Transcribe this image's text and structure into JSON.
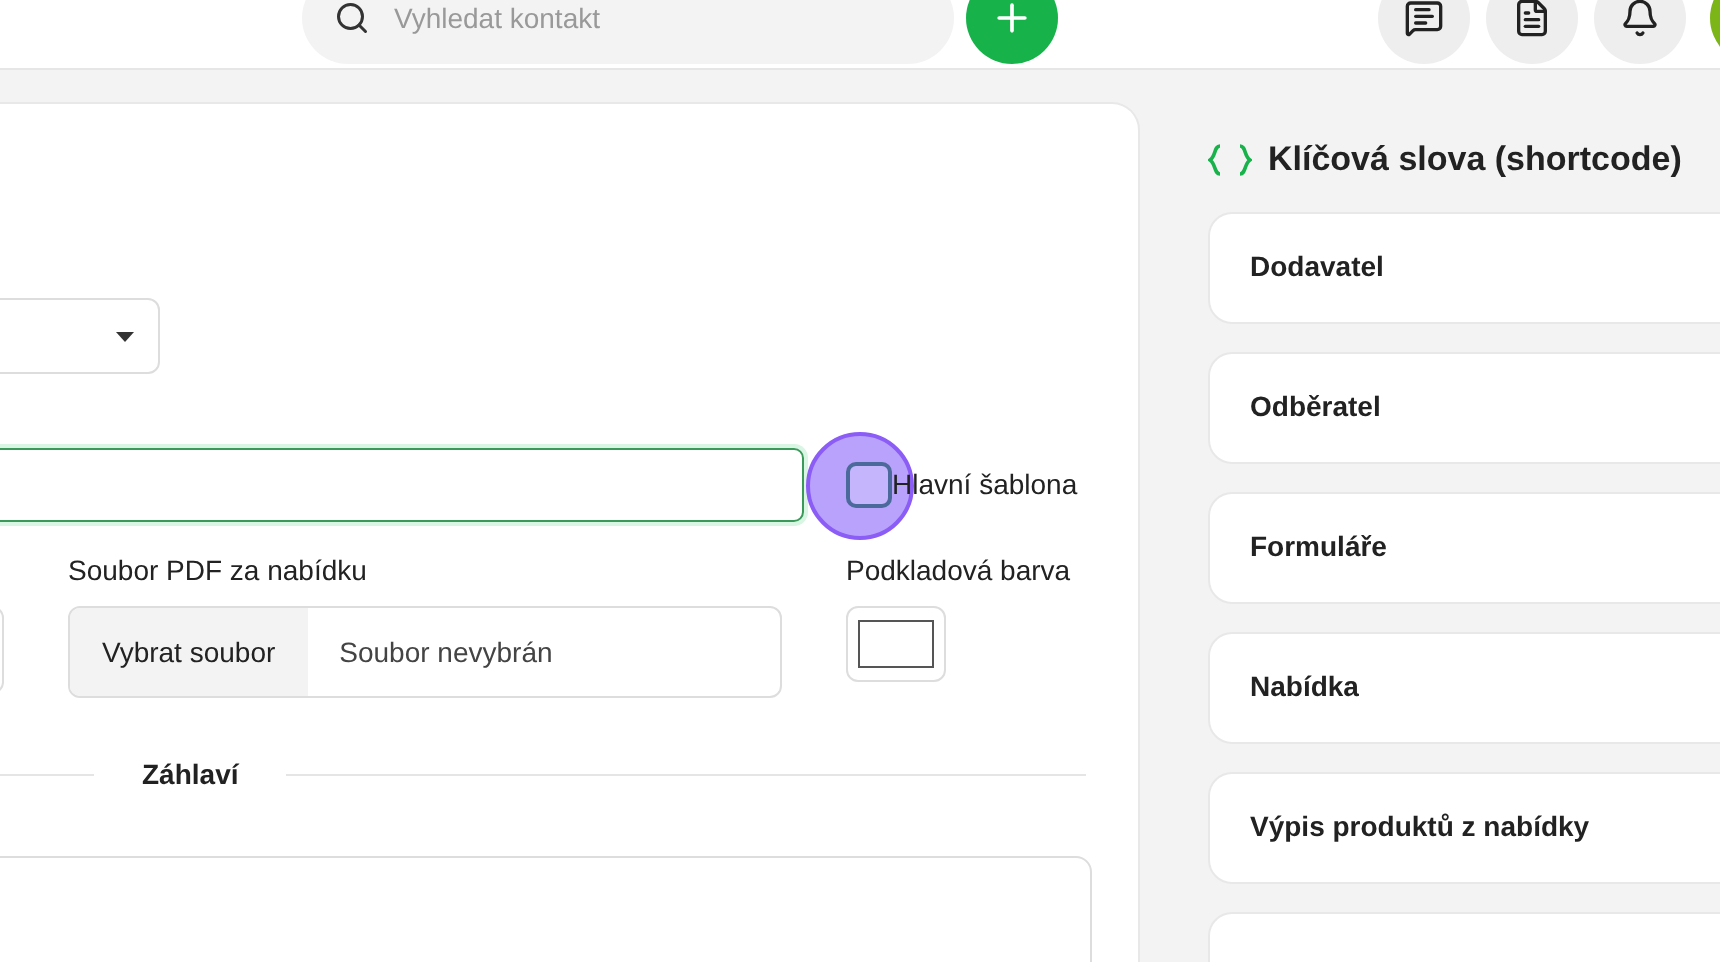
{
  "header": {
    "search": {
      "placeholder": "Vyhledat kontakt"
    }
  },
  "form": {
    "main_template": {
      "label": "Hlavní šablona",
      "checked": false
    },
    "pdf_file": {
      "label": "Soubor PDF za nabídku",
      "button": "Vybrat soubor",
      "value": "Soubor nevybrán"
    },
    "background_color": {
      "label": "Podkladová barva",
      "color": "#ffffff"
    },
    "section_title": "Záhlaví"
  },
  "shortcodes": {
    "title": "Klíčová slova (shortcode)",
    "items": [
      {
        "label": "Dodavatel"
      },
      {
        "label": "Odběratel"
      },
      {
        "label": "Formuláře"
      },
      {
        "label": "Nabídka"
      },
      {
        "label": "Výpis produktů z nabídky"
      }
    ]
  }
}
